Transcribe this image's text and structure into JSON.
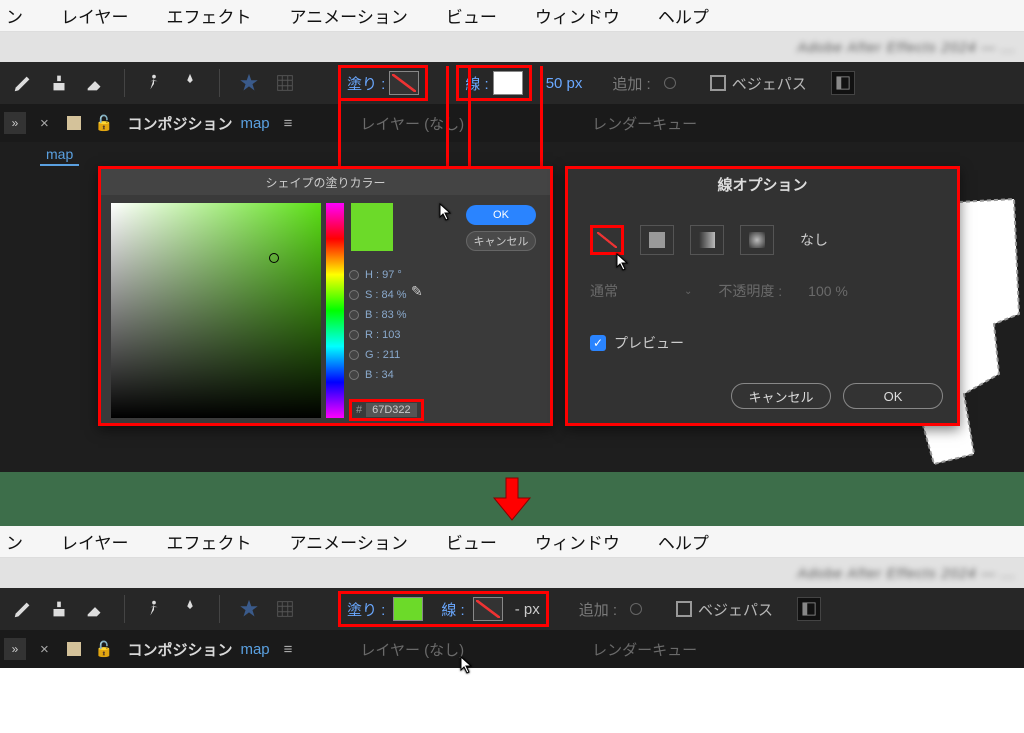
{
  "menubar": {
    "items": [
      "ン",
      "レイヤー",
      "エフェクト",
      "アニメーション",
      "ビュー",
      "ウィンドウ",
      "ヘルプ"
    ]
  },
  "titlebar": {
    "blur": "Adobe After Effects 2024 — ..."
  },
  "toolbar": {
    "fill_label": "塗り :",
    "stroke_label": "線 :",
    "stroke_px_before": "50 px",
    "stroke_px_after": "- px",
    "add_label": "追加 :",
    "bezier_label": "ベジェパス"
  },
  "tabs": {
    "comp_word": "コンポジション",
    "comp_name": "map",
    "layer_none": "レイヤー (なし)",
    "render_queue": "レンダーキュー",
    "sub_tab": "map"
  },
  "fill_dialog": {
    "title": "シェイプの塗りカラー",
    "ok": "OK",
    "cancel": "キャンセル",
    "values": {
      "h": "H : 97 °",
      "s": "S : 84 %",
      "b": "B : 83 %",
      "r": "R : 103",
      "g": "G : 211",
      "b2": "B : 34"
    },
    "hex": "67D322"
  },
  "stroke_dialog": {
    "title": "線オプション",
    "type_none_label": "なし",
    "blend_mode": "通常",
    "opacity_label": "不透明度 :",
    "opacity_value": "100 %",
    "preview": "プレビュー",
    "cancel": "キャンセル",
    "ok": "OK"
  },
  "colors": {
    "fill_after": "#6CDA29"
  }
}
